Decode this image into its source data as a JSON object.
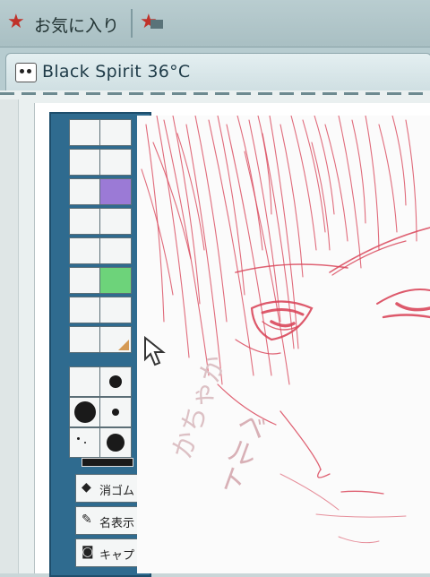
{
  "favorites_bar": {
    "label": "お気に入り",
    "star_icon": "favorites-star-icon",
    "add_icon": "add-favorites-icon"
  },
  "tab": {
    "title": "Black Spirit 36°C",
    "favicon": "site-favicon"
  },
  "palette": {
    "colors": [
      "#f4f6f6",
      "#f4f6f6",
      "#f4f6f6",
      "#f4f6f6",
      "#f4f6f6",
      "#9b7ad6",
      "#f4f6f6",
      "#f4f6f6",
      "#f4f6f6",
      "#f4f6f6",
      "#f4f6f6",
      "#6dd37a",
      "#f4f6f6",
      "#f4f6f6",
      "#f4f6f6",
      "#f4f6f6"
    ],
    "tools": [
      {
        "label": "消ゴム",
        "icon": "eraser-icon"
      },
      {
        "label": "名表示",
        "icon": "pencil-icon"
      },
      {
        "label": "キャプ",
        "icon": "camera-icon"
      }
    ]
  },
  "canvas": {
    "stroke_color": "#d9475b",
    "handwriting_vertical": "ベルト",
    "handwriting_slanted": "かちゃか"
  }
}
